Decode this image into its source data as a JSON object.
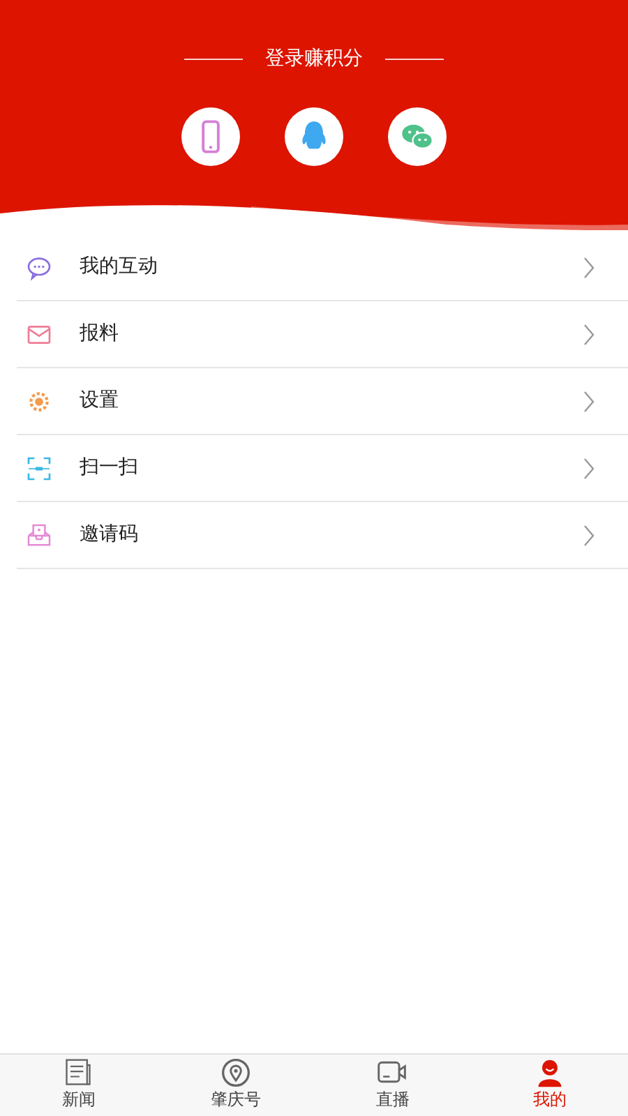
{
  "header": {
    "title": "登录赚积分",
    "login_options": [
      {
        "kind": "phone"
      },
      {
        "kind": "qq"
      },
      {
        "kind": "wechat"
      }
    ]
  },
  "menu": [
    {
      "kind": "chat",
      "label": "我的互动"
    },
    {
      "kind": "mail",
      "label": "报料"
    },
    {
      "kind": "gear",
      "label": "设置"
    },
    {
      "kind": "scan",
      "label": "扫一扫"
    },
    {
      "kind": "invite",
      "label": "邀请码"
    }
  ],
  "tab_bar": [
    {
      "kind": "news",
      "label": "新闻",
      "selected": false
    },
    {
      "kind": "pin",
      "label": "肇庆号",
      "selected": false
    },
    {
      "kind": "video",
      "label": "直播",
      "selected": false
    },
    {
      "kind": "person",
      "label": "我的",
      "selected": true
    }
  ]
}
